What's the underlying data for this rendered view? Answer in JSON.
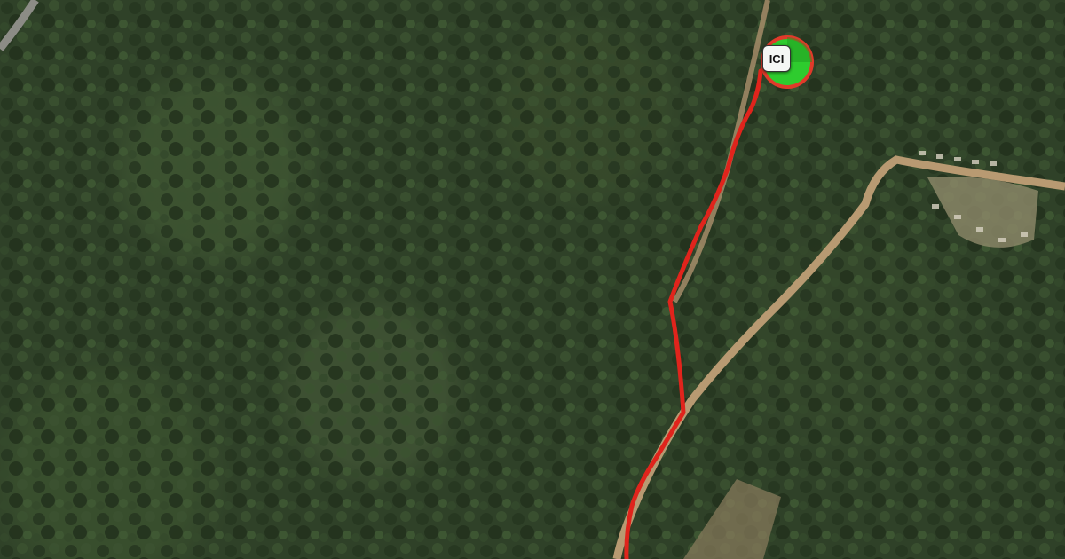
{
  "map": {
    "view": "satellite",
    "marker": {
      "label": "ICI",
      "fill_color": "#2ecc2e",
      "ring_color": "#e03a2a"
    },
    "route": {
      "color": "#e0241c"
    },
    "colors": {
      "forest": "#2f4128",
      "dirt_road": "#b89a72",
      "clearing": "#8f8a6a"
    }
  }
}
